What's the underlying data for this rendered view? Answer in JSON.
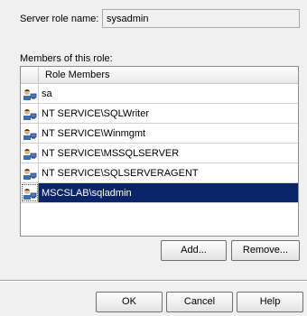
{
  "server_role": {
    "label": "Server role name:",
    "value": "sysadmin"
  },
  "members": {
    "label": "Members of this role:",
    "column_header": "Role Members",
    "rows": [
      {
        "name": "sa",
        "icon": "user-icon",
        "selected": false
      },
      {
        "name": "NT SERVICE\\SQLWriter",
        "icon": "user-icon",
        "selected": false
      },
      {
        "name": "NT SERVICE\\Winmgmt",
        "icon": "user-icon",
        "selected": false
      },
      {
        "name": "NT SERVICE\\MSSQLSERVER",
        "icon": "user-icon",
        "selected": false
      },
      {
        "name": "NT SERVICE\\SQLSERVERAGENT",
        "icon": "user-icon",
        "selected": false
      },
      {
        "name": "MSCSLAB\\sqladmin",
        "icon": "user-icon",
        "selected": true
      }
    ]
  },
  "buttons": {
    "add": "Add...",
    "remove": "Remove...",
    "ok": "OK",
    "cancel": "Cancel",
    "help": "Help"
  },
  "colors": {
    "selection": "#0a246a",
    "background": "#f0f0f0"
  }
}
